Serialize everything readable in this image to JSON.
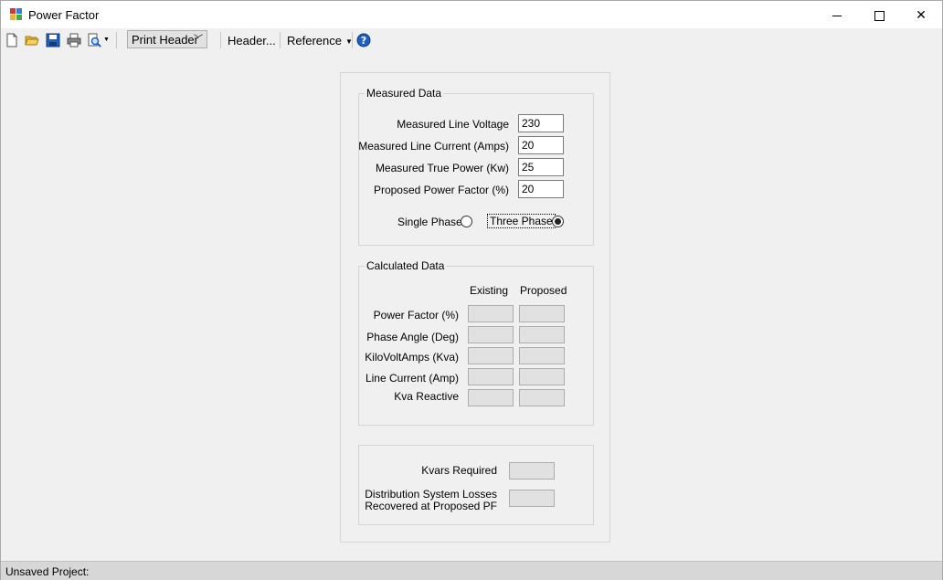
{
  "window": {
    "title": "Power Factor"
  },
  "toolbar": {
    "print_header_label": "Print Header",
    "header_label": "Header...",
    "reference_label": "Reference"
  },
  "measured": {
    "title": "Measured Data",
    "fields": [
      {
        "label": "Measured Line Voltage",
        "value": "230"
      },
      {
        "label": "Measured Line Current (Amps)",
        "value": "20"
      },
      {
        "label": "Measured True Power (Kw)",
        "value": "25"
      },
      {
        "label": "Proposed Power Factor (%)",
        "value": "20"
      }
    ],
    "single_phase_label": "Single Phase",
    "three_phase_label": "Three Phase",
    "selected_phase": "three"
  },
  "calculated": {
    "title": "Calculated Data",
    "col_existing": "Existing",
    "col_proposed": "Proposed",
    "rows": [
      {
        "label": "Power Factor (%)"
      },
      {
        "label": "Phase Angle (Deg)"
      },
      {
        "label": "KiloVoltAmps (Kva)"
      },
      {
        "label": "Line Current (Amp)"
      },
      {
        "label": "Kva Reactive"
      }
    ]
  },
  "results": {
    "kvars_label": "Kvars Required",
    "losses_label_line1": "Distribution System Losses",
    "losses_label_line2": "Recovered at Proposed PF"
  },
  "status": {
    "text": "Unsaved Project:"
  },
  "colors": {
    "accent_blue": "#1e5fbf",
    "folder_yellow": "#e8b730"
  }
}
